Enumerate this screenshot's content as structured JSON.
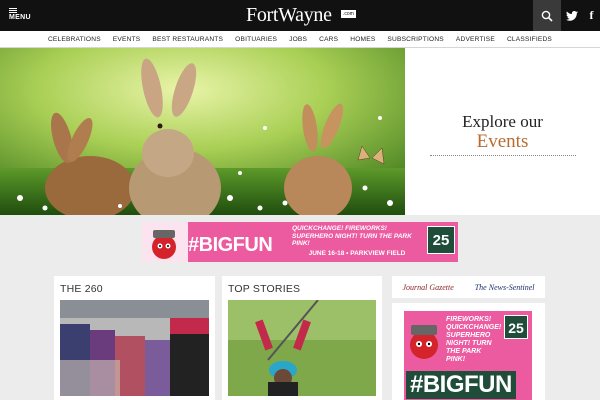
{
  "header": {
    "menu_label": "MENU",
    "logo_text": "FortWayne",
    "logo_suffix": ".com"
  },
  "nav": {
    "items": [
      "CELEBRATIONS",
      "EVENTS",
      "BEST RESTAURANTS",
      "OBITUARIES",
      "JOBS",
      "CARS",
      "HOMES",
      "SUBSCRIPTIONS",
      "ADVERTISE",
      "CLASSIFIEDS"
    ]
  },
  "hero": {
    "icon": "easter-bunnies-photo"
  },
  "explore": {
    "line1": "Explore our",
    "line2": "Events",
    "accent_color": "#b96b2e"
  },
  "banner": {
    "hashtag": "#BIGFUN",
    "promo": "QUICKCHANGE! FIREWORKS! SUPERHERO NIGHT! TURN THE PARK PINK!",
    "dates": "JUNE 16-18 • PARKVIEW FIELD",
    "anniversary": "25",
    "color": "#ec5aa0"
  },
  "cards": {
    "the260": {
      "title": "THE 260"
    },
    "top_stories": {
      "title": "TOP STORIES"
    }
  },
  "newspapers": {
    "journal": "Journal Gazette",
    "news": "The News-Sentinel"
  },
  "side_ad": {
    "promo": "FIREWORKS! QUICKCHANGE! SUPERHERO NIGHT! TURN THE PARK PINK!",
    "hashtag": "#BIGFUN",
    "anniversary": "25"
  }
}
